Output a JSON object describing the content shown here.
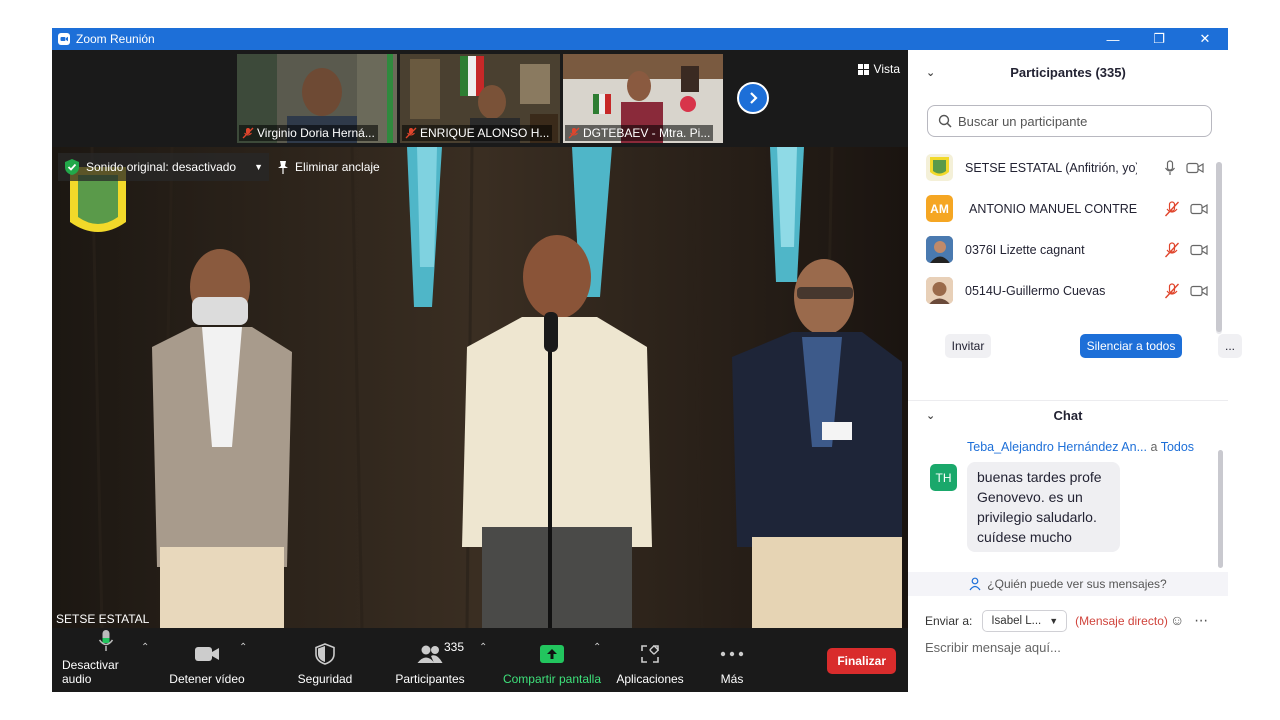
{
  "titlebar": {
    "title": "Zoom Reunión"
  },
  "thumbnails": [
    {
      "label": "Virginio Doria Herná..."
    },
    {
      "label": "ENRIQUE ALONSO H..."
    },
    {
      "label": "DGTEBAEV - Mtra. Pi..."
    }
  ],
  "view": {
    "label": "Vista"
  },
  "stage": {
    "sound_label": "Sonido original: desactivado",
    "unpin_label": "Eliminar anclaje",
    "speaker_name": "SETSE ESTATAL"
  },
  "toolbar": {
    "mute_label": "Desactivar audio",
    "video_label": "Detener vídeo",
    "security_label": "Seguridad",
    "participants_label": "Participantes",
    "participants_count": "335",
    "share_label": "Compartir pantalla",
    "apps_label": "Aplicaciones",
    "more_label": "Más",
    "end_label": "Finalizar"
  },
  "participants_panel": {
    "title": "Participantes (335)",
    "search_placeholder": "Buscar un participante",
    "items": [
      {
        "name": "SETSE ESTATAL (Anfitrión, yo)",
        "avatar": "",
        "mic": "on"
      },
      {
        "name": "ANTONIO MANUEL CONTRER...",
        "avatar": "AM",
        "mic": "muted"
      },
      {
        "name": "0376I Lizette cagnant",
        "avatar": "",
        "mic": "muted"
      },
      {
        "name": "0514U-Guillermo Cuevas",
        "avatar": "",
        "mic": "muted"
      }
    ],
    "invite_label": "Invitar",
    "mute_all_label": "Silenciar a todos",
    "more_label": "..."
  },
  "chat": {
    "title": "Chat",
    "message": {
      "sender": "Teba_Alejandro Hernández An...",
      "to_word": "a",
      "recipient": "Todos",
      "avatar": "TH",
      "text": "buenas tardes profe Genovevo. es un privilegio saludarlo. cuídese mucho"
    },
    "who_can_see": "¿Quién puede ver sus mensajes?",
    "send_to_label": "Enviar a:",
    "send_to_value": "Isabel L...",
    "direct_label": "(Mensaje directo)",
    "input_placeholder": "Escribir mensaje aquí..."
  },
  "colors": {
    "titlebar": "#1d6fd8",
    "accent_blue": "#1d6fd8",
    "end_red": "#d92c2c",
    "muted_red": "#e0452c",
    "share_green": "#22c55e"
  }
}
